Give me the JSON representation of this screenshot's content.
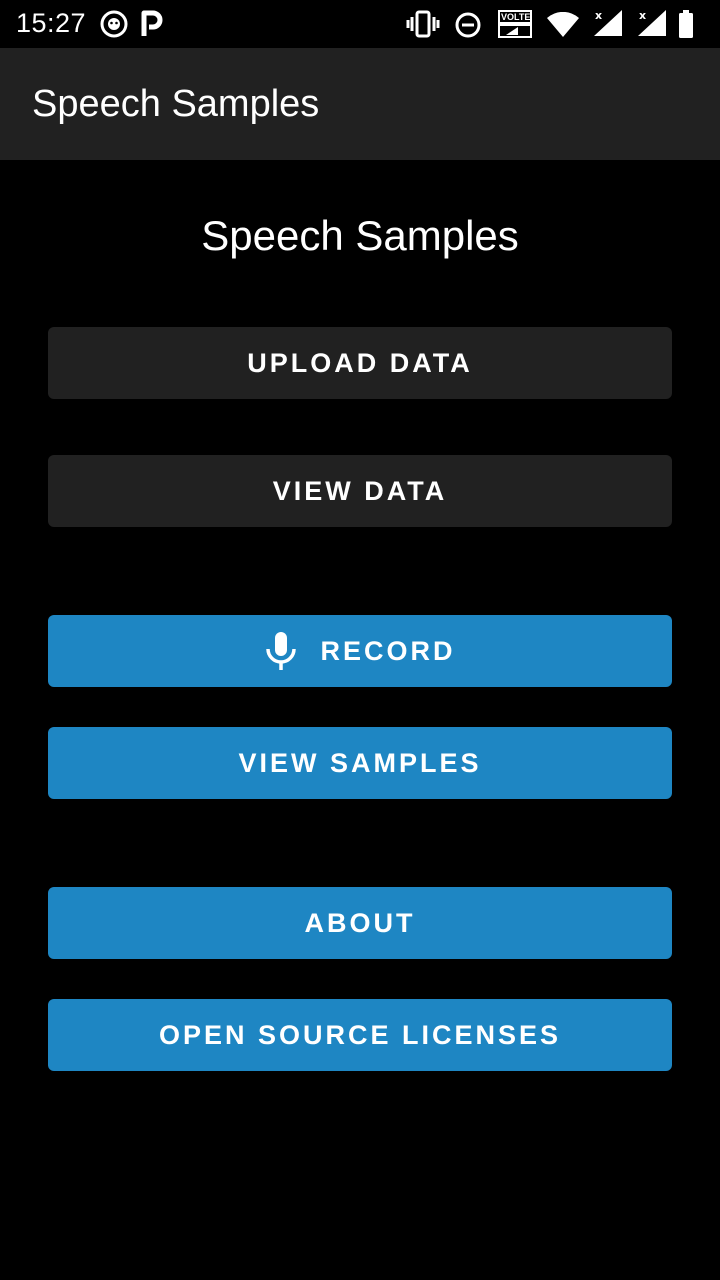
{
  "status_bar": {
    "time": "15:27",
    "left_icons": [
      "shield-face-icon",
      "parking-p-icon"
    ],
    "right_icons": [
      "vibrate-icon",
      "do-not-disturb-icon",
      "volte-icon",
      "wifi-icon",
      "signal-icon",
      "signal-icon",
      "battery-icon"
    ],
    "volte_label": "VOLTE"
  },
  "app_bar": {
    "title": "Speech Samples"
  },
  "main": {
    "title": "Speech Samples",
    "buttons": {
      "upload_data": "UPLOAD DATA",
      "view_data": "VIEW DATA",
      "record": "RECORD",
      "view_samples": "VIEW SAMPLES",
      "about": "ABOUT",
      "open_source_licenses": "OPEN SOURCE LICENSES"
    }
  },
  "colors": {
    "background": "#000000",
    "app_bar": "#212121",
    "dark_button": "#212121",
    "accent_button": "#1e86c3",
    "text": "#ffffff"
  }
}
